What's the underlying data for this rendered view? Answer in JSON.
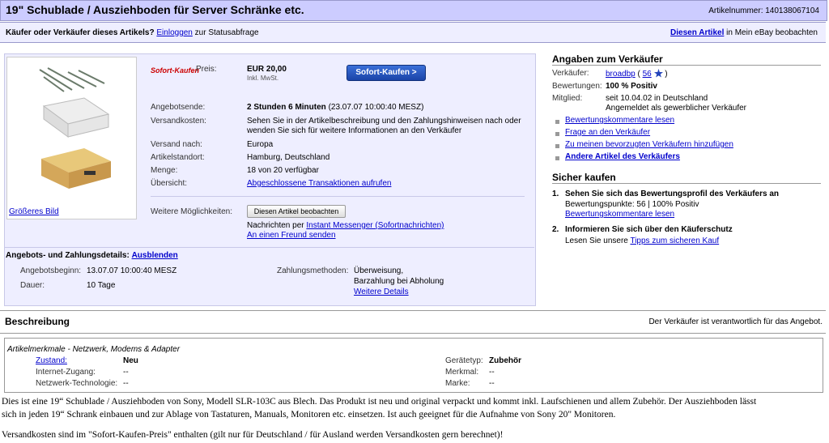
{
  "header": {
    "title": "19\" Schublade / Ausziehboden für Server Schränke etc.",
    "article_number": "Artikelnummer: 140138067104"
  },
  "subbar": {
    "question": "Käufer oder Verkäufer dieses Artikels?",
    "login_link": "Einloggen",
    "login_suffix": "zur Statusabfrage",
    "watch_link": "Diesen Artikel",
    "watch_suffix": "in Mein eBay beobachten"
  },
  "item": {
    "image_link": "Größeres Bild",
    "sofort_logo": "Sofort-Kaufen",
    "price_label": "Preis:",
    "price": "EUR 20,00",
    "price_note": "Inkl. MwSt.",
    "buy_button": "Sofort-Kaufen >",
    "end_label": "Angebotsende:",
    "end_value_bold": "2 Stunden 6 Minuten",
    "end_value_rest": "(23.07.07 10:00:40 MESZ)",
    "shipping_label": "Versandkosten:",
    "shipping_line1": "Sehen Sie in der Artikelbeschreibung und den Zahlungshinweisen nach oder",
    "shipping_line2": "wenden Sie sich für weitere Informationen an den Verkäufer",
    "ship_to_label": "Versand nach:",
    "ship_to": "Europa",
    "location_label": "Artikelstandort:",
    "location": "Hamburg, Deutschland",
    "quantity_label": "Menge:",
    "quantity": "18 von 20 verfügbar",
    "overview_label": "Übersicht:",
    "overview_link": "Abgeschlossene Transaktionen aufrufen",
    "more_label": "Weitere Möglichkeiten:",
    "watch_button": "Diesen Artikel beobachten",
    "messages_prefix": "Nachrichten per",
    "messenger_link": "Instant Messenger (Sofortnachrichten)",
    "friend_link": "An einen Freund senden"
  },
  "details": {
    "heading": "Angebots- und Zahlungsdetails:",
    "hide_link": "Ausblenden",
    "start_label": "Angebotsbeginn:",
    "start": "13.07.07 10:00:40 MESZ",
    "duration_label": "Dauer:",
    "duration": "10 Tage",
    "payment_label": "Zahlungsmethoden:",
    "payment_1": "Überweisung,",
    "payment_2": "Barzahlung bei Abholung",
    "payment_more": "Weitere Details"
  },
  "seller": {
    "heading": "Angaben zum Verkäufer",
    "seller_label": "Verkäufer:",
    "seller_name": "broadbp",
    "rating_count": "56",
    "paren_open": "(",
    "paren_close": ")",
    "ratings_label": "Bewertungen:",
    "ratings": "100 % Positiv",
    "member_label": "Mitglied:",
    "member_since": "seit 10.04.02 in Deutschland",
    "member_note": "Angemeldet als gewerblicher Verkäufer",
    "links": [
      "Bewertungskommentare lesen",
      "Frage an den Verkäufer",
      "Zu meinen bevorzugten Verkäufern hinzufügen",
      "Andere Artikel des Verkäufers"
    ]
  },
  "safe": {
    "heading": "Sicher kaufen",
    "step1_num": "1.",
    "step1_title": "Sehen Sie sich das Bewertungsprofil des Verkäufers an",
    "step1_points": "Bewertungspunkte: 56 | 100% Positiv",
    "step1_link": "Bewertungskommentare lesen",
    "step2_num": "2.",
    "step2_title": "Informieren Sie sich über den Käuferschutz",
    "step2_prefix": "Lesen Sie unsere",
    "step2_link": "Tipps zum sicheren Kauf"
  },
  "description": {
    "heading": "Beschreibung",
    "responsibility": "Der Verkäufer ist verantwortlich für das Angebot.",
    "attr_heading": "Artikelmerkmale - Netzwerk, Modems & Adapter",
    "attrs_left": [
      {
        "label": "Zustand:",
        "value": "Neu"
      },
      {
        "label": "Internet-Zugang:",
        "value": "--"
      },
      {
        "label": "Netzwerk-Technologie:",
        "value": "--"
      }
    ],
    "attrs_right": [
      {
        "label": "Gerätetyp:",
        "value": "Zubehör"
      },
      {
        "label": "Merkmal:",
        "value": "--"
      },
      {
        "label": "Marke:",
        "value": "--"
      }
    ],
    "text_line1": "Dies ist eine 19“ Schublade / Ausziehboden von Sony, Modell SLR-103C aus Blech. Das Produkt ist neu und original verpackt und kommt inkl. Laufschienen und allem Zubehör. Der Ausziehboden lässt",
    "text_line2": "sich in jeden 19“ Schrank einbauen und zur Ablage von Tastaturen, Manuals, Monitoren etc. einsetzen. Ist auch geeignet für die Aufnahme von Sony 20\" Monitoren.",
    "text_line3": "Versandkosten sind im \"Sofort-Kaufen-Preis\" enthalten (gilt nur für Deutschland / für Ausland werden Versandkosten gern berechnet)!"
  },
  "colors": {
    "header_bg": "#ccccff",
    "box_bg": "#eeeeff",
    "link": "#0000cc",
    "buy_button": "#2a55c0",
    "logo_red": "#cc0000"
  }
}
